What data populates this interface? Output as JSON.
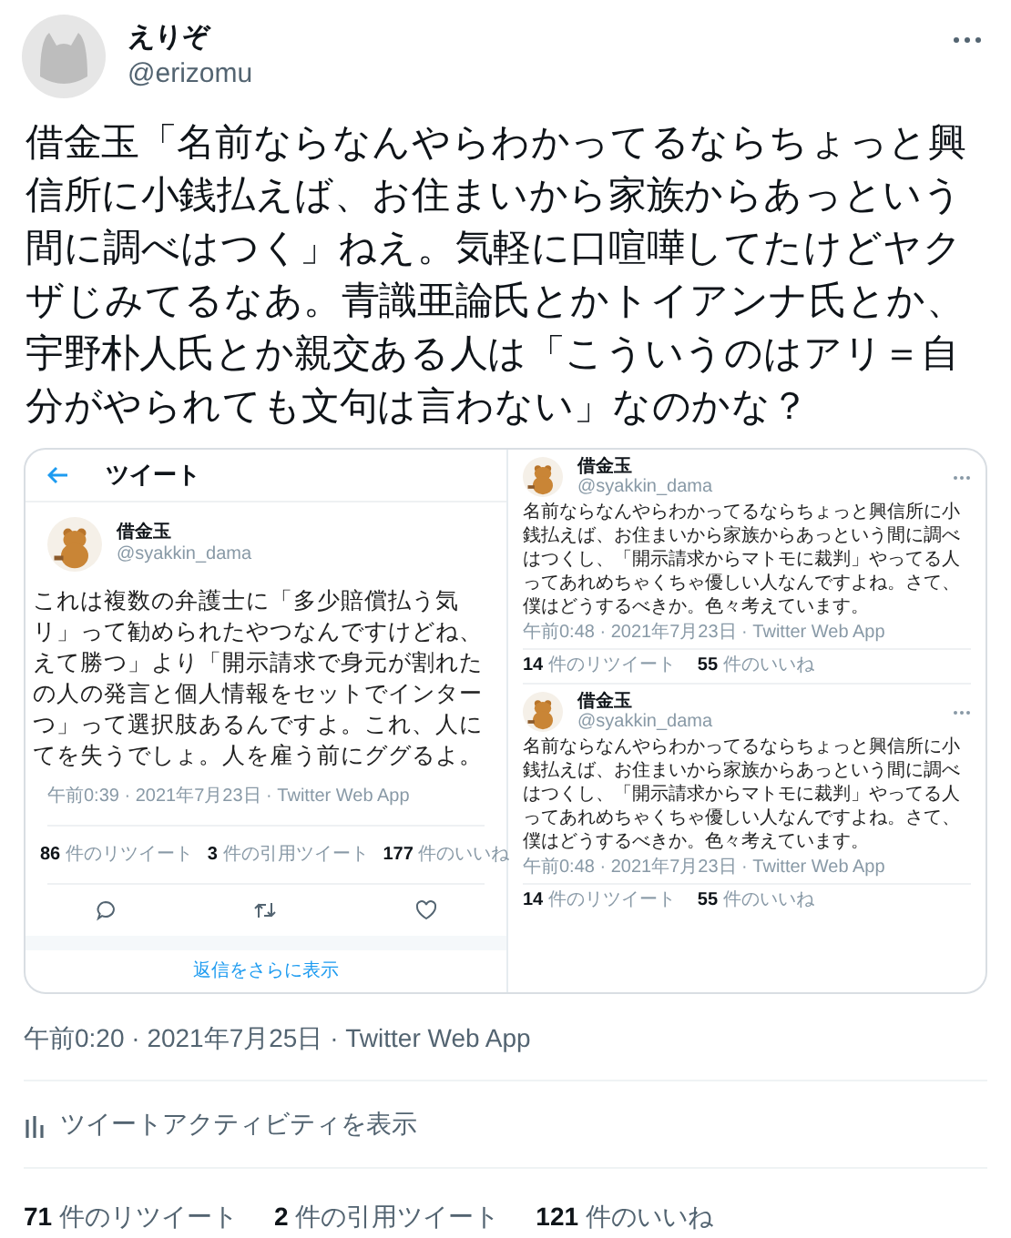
{
  "author": {
    "name": "えりぞ",
    "handle": "@erizomu"
  },
  "body": "借金玉「名前ならなんやらわかってるならちょっと興信所に小銭払えば、お住まいから家族からあっという間に調べはつく」ねえ。気軽に口喧嘩してたけどヤクザじみてるなあ。青識亜論氏とかトイアンナ氏とか、宇野朴人氏とか親交ある人は「こういうのはアリ＝自分がやられても文句は言わない」なのかな？",
  "embedded_screenshot": {
    "left_panel": {
      "header_title": "ツイート",
      "author": {
        "name": "借金玉",
        "handle": "@syakkin_dama"
      },
      "body_lines": [
        "これは複数の弁護士に「多少賠償払う気",
        "リ」って勧められたやつなんですけどね、",
        "えて勝つ」より「開示請求で身元が割れた",
        "の人の発言と個人情報をセットでインター",
        "つ」って選択肢あるんですよ。これ、人に",
        "てを失うでしょ。人を雇う前にググるよ。"
      ],
      "meta": "午前0:39 · 2021年7月23日 · Twitter Web App",
      "stats": [
        {
          "count": "86",
          "label": "件のリツイート"
        },
        {
          "count": "3",
          "label": "件の引用ツイート"
        },
        {
          "count": "177",
          "label": "件のいいね"
        }
      ],
      "show_more_replies": "返信をさらに表示"
    },
    "right_panel": {
      "tweets": [
        {
          "author": {
            "name": "借金玉",
            "handle": "@syakkin_dama"
          },
          "body": "名前ならなんやらわかってるならちょっと興信所に小銭払えば、お住まいから家族からあっという間に調べはつくし、「開示請求からマトモに裁判」やってる人ってあれめちゃくちゃ優しい人なんですよね。さて、僕はどうするべきか。色々考えています。",
          "meta": "午前0:48 · 2021年7月23日 · Twitter Web App",
          "stats": [
            {
              "count": "14",
              "label": "件のリツイート"
            },
            {
              "count": "55",
              "label": "件のいいね"
            }
          ]
        },
        {
          "author": {
            "name": "借金玉",
            "handle": "@syakkin_dama"
          },
          "body": "名前ならなんやらわかってるならちょっと興信所に小銭払えば、お住まいから家族からあっという間に調べはつくし、「開示請求からマトモに裁判」やってる人ってあれめちゃくちゃ優しい人なんですよね。さて、僕はどうするべきか。色々考えています。",
          "meta": "午前0:48 · 2021年7月23日 · Twitter Web App",
          "stats": [
            {
              "count": "14",
              "label": "件のリツイート"
            },
            {
              "count": "55",
              "label": "件のいいね"
            }
          ]
        }
      ]
    }
  },
  "meta": "午前0:20 · 2021年7月25日 · Twitter Web App",
  "activity_link": "ツイートアクティビティを表示",
  "stats": [
    {
      "count": "71",
      "label": "件のリツイート"
    },
    {
      "count": "2",
      "label": "件の引用ツイート"
    },
    {
      "count": "121",
      "label": "件のいいね"
    }
  ]
}
